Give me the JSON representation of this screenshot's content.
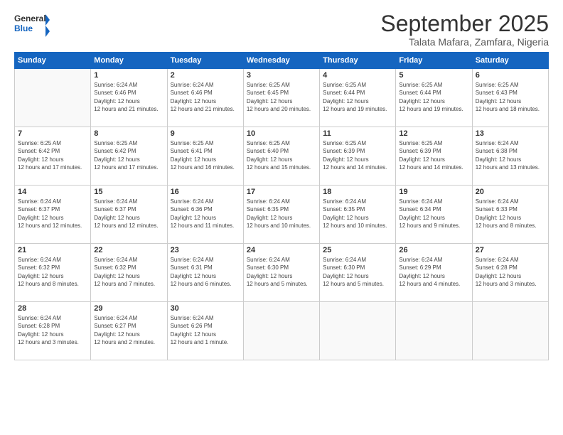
{
  "logo": {
    "general": "General",
    "blue": "Blue"
  },
  "header": {
    "month": "September 2025",
    "location": "Talata Mafara, Zamfara, Nigeria"
  },
  "weekdays": [
    "Sunday",
    "Monday",
    "Tuesday",
    "Wednesday",
    "Thursday",
    "Friday",
    "Saturday"
  ],
  "weeks": [
    [
      {
        "day": null
      },
      {
        "day": 1,
        "sunrise": "6:24 AM",
        "sunset": "6:46 PM",
        "daylight": "12 hours and 21 minutes."
      },
      {
        "day": 2,
        "sunrise": "6:24 AM",
        "sunset": "6:46 PM",
        "daylight": "12 hours and 21 minutes."
      },
      {
        "day": 3,
        "sunrise": "6:25 AM",
        "sunset": "6:45 PM",
        "daylight": "12 hours and 20 minutes."
      },
      {
        "day": 4,
        "sunrise": "6:25 AM",
        "sunset": "6:44 PM",
        "daylight": "12 hours and 19 minutes."
      },
      {
        "day": 5,
        "sunrise": "6:25 AM",
        "sunset": "6:44 PM",
        "daylight": "12 hours and 19 minutes."
      },
      {
        "day": 6,
        "sunrise": "6:25 AM",
        "sunset": "6:43 PM",
        "daylight": "12 hours and 18 minutes."
      }
    ],
    [
      {
        "day": 7,
        "sunrise": "6:25 AM",
        "sunset": "6:42 PM",
        "daylight": "12 hours and 17 minutes."
      },
      {
        "day": 8,
        "sunrise": "6:25 AM",
        "sunset": "6:42 PM",
        "daylight": "12 hours and 17 minutes."
      },
      {
        "day": 9,
        "sunrise": "6:25 AM",
        "sunset": "6:41 PM",
        "daylight": "12 hours and 16 minutes."
      },
      {
        "day": 10,
        "sunrise": "6:25 AM",
        "sunset": "6:40 PM",
        "daylight": "12 hours and 15 minutes."
      },
      {
        "day": 11,
        "sunrise": "6:25 AM",
        "sunset": "6:39 PM",
        "daylight": "12 hours and 14 minutes."
      },
      {
        "day": 12,
        "sunrise": "6:25 AM",
        "sunset": "6:39 PM",
        "daylight": "12 hours and 14 minutes."
      },
      {
        "day": 13,
        "sunrise": "6:24 AM",
        "sunset": "6:38 PM",
        "daylight": "12 hours and 13 minutes."
      }
    ],
    [
      {
        "day": 14,
        "sunrise": "6:24 AM",
        "sunset": "6:37 PM",
        "daylight": "12 hours and 12 minutes."
      },
      {
        "day": 15,
        "sunrise": "6:24 AM",
        "sunset": "6:37 PM",
        "daylight": "12 hours and 12 minutes."
      },
      {
        "day": 16,
        "sunrise": "6:24 AM",
        "sunset": "6:36 PM",
        "daylight": "12 hours and 11 minutes."
      },
      {
        "day": 17,
        "sunrise": "6:24 AM",
        "sunset": "6:35 PM",
        "daylight": "12 hours and 10 minutes."
      },
      {
        "day": 18,
        "sunrise": "6:24 AM",
        "sunset": "6:35 PM",
        "daylight": "12 hours and 10 minutes."
      },
      {
        "day": 19,
        "sunrise": "6:24 AM",
        "sunset": "6:34 PM",
        "daylight": "12 hours and 9 minutes."
      },
      {
        "day": 20,
        "sunrise": "6:24 AM",
        "sunset": "6:33 PM",
        "daylight": "12 hours and 8 minutes."
      }
    ],
    [
      {
        "day": 21,
        "sunrise": "6:24 AM",
        "sunset": "6:32 PM",
        "daylight": "12 hours and 8 minutes."
      },
      {
        "day": 22,
        "sunrise": "6:24 AM",
        "sunset": "6:32 PM",
        "daylight": "12 hours and 7 minutes."
      },
      {
        "day": 23,
        "sunrise": "6:24 AM",
        "sunset": "6:31 PM",
        "daylight": "12 hours and 6 minutes."
      },
      {
        "day": 24,
        "sunrise": "6:24 AM",
        "sunset": "6:30 PM",
        "daylight": "12 hours and 5 minutes."
      },
      {
        "day": 25,
        "sunrise": "6:24 AM",
        "sunset": "6:30 PM",
        "daylight": "12 hours and 5 minutes."
      },
      {
        "day": 26,
        "sunrise": "6:24 AM",
        "sunset": "6:29 PM",
        "daylight": "12 hours and 4 minutes."
      },
      {
        "day": 27,
        "sunrise": "6:24 AM",
        "sunset": "6:28 PM",
        "daylight": "12 hours and 3 minutes."
      }
    ],
    [
      {
        "day": 28,
        "sunrise": "6:24 AM",
        "sunset": "6:28 PM",
        "daylight": "12 hours and 3 minutes."
      },
      {
        "day": 29,
        "sunrise": "6:24 AM",
        "sunset": "6:27 PM",
        "daylight": "12 hours and 2 minutes."
      },
      {
        "day": 30,
        "sunrise": "6:24 AM",
        "sunset": "6:26 PM",
        "daylight": "12 hours and 1 minute."
      },
      {
        "day": null
      },
      {
        "day": null
      },
      {
        "day": null
      },
      {
        "day": null
      }
    ]
  ]
}
